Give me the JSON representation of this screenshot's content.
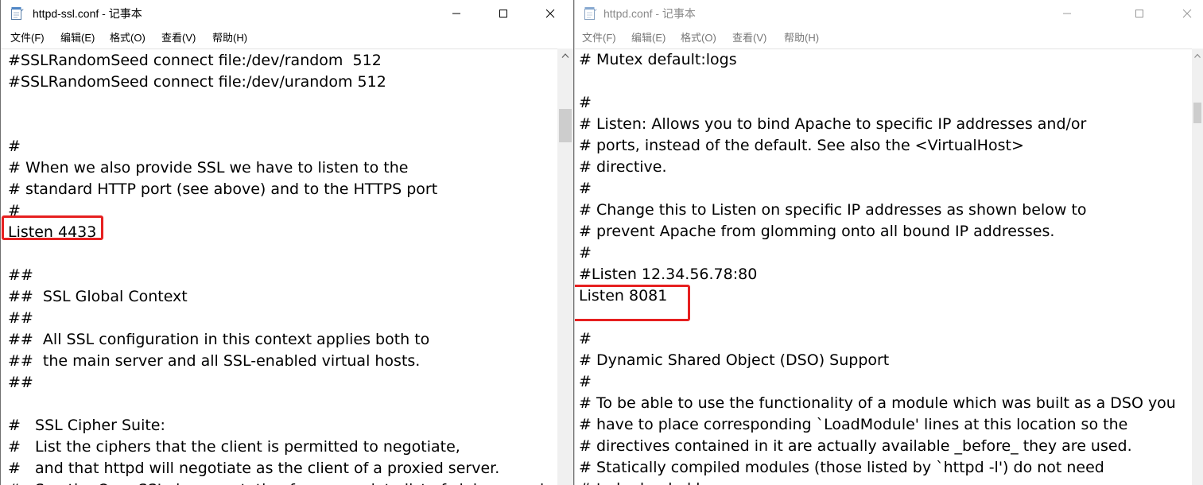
{
  "colors": {
    "highlight": "#e62020",
    "inactive_title": "#8a8a8a",
    "scrollbar_track": "#f0f0f0"
  },
  "left_window": {
    "title": "httpd-ssl.conf - 记事本",
    "icons": {
      "app": "notepad-icon",
      "minimize": "minimize-icon",
      "maximize": "maximize-icon",
      "close": "close-icon"
    },
    "menu": [
      "文件(F)",
      "编辑(E)",
      "格式(O)",
      "查看(V)",
      "帮助(H)"
    ],
    "lines": [
      "#SSLRandomSeed connect file:/dev/random  512",
      "#SSLRandomSeed connect file:/dev/urandom 512",
      "",
      "",
      "#",
      "# When we also provide SSL we have to listen to the",
      "# standard HTTP port (see above) and to the HTTPS port",
      "#",
      "Listen 4433",
      "",
      "##",
      "##  SSL Global Context",
      "##",
      "##  All SSL configuration in this context applies both to",
      "##  the main server and all SSL-enabled virtual hosts.",
      "##",
      "",
      "#   SSL Cipher Suite:",
      "#   List the ciphers that the client is permitted to negotiate,",
      "#   and that httpd will negotiate as the client of a proxied server.",
      "#   See the OpenSSL documentation for a complete list of ciphers, and"
    ]
  },
  "right_window": {
    "title": "httpd.conf - 记事本",
    "icons": {
      "app": "notepad-icon",
      "minimize": "minimize-icon",
      "maximize": "maximize-icon",
      "close": "close-icon"
    },
    "menu": [
      "文件(F)",
      "编辑(E)",
      "格式(O)",
      "查看(V)",
      "帮助(H)"
    ],
    "lines": [
      "# Mutex default:logs",
      "",
      "#",
      "# Listen: Allows you to bind Apache to specific IP addresses and/or",
      "# ports, instead of the default. See also the <VirtualHost>",
      "# directive.",
      "#",
      "# Change this to Listen on specific IP addresses as shown below to",
      "# prevent Apache from glomming onto all bound IP addresses.",
      "#",
      "#Listen 12.34.56.78:80",
      "Listen 8081",
      "",
      "#",
      "# Dynamic Shared Object (DSO) Support",
      "#",
      "# To be able to use the functionality of a module which was built as a DSO you",
      "# have to place corresponding `LoadModule' lines at this location so the",
      "# directives contained in it are actually available _before_ they are used.",
      "# Statically compiled modules (those listed by `httpd -l') do not need",
      "# to be loaded here."
    ]
  }
}
